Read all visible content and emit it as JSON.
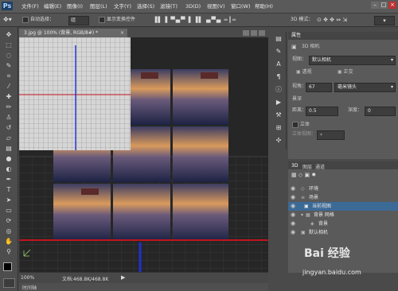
{
  "app": {
    "logo": "Ps"
  },
  "menu": [
    "文件(F)",
    "编辑(E)",
    "图像(I)",
    "图层(L)",
    "文字(Y)",
    "选择(S)",
    "滤镜(T)",
    "3D(D)",
    "视图(V)",
    "窗口(W)",
    "帮助(H)"
  ],
  "window_controls": [
    "–",
    "□",
    "×"
  ],
  "options": {
    "auto_select_label": "自动选择：",
    "auto_select_value": "组",
    "show_transform_label": "显示变换控件",
    "mode_3d_label": "3D 模式："
  },
  "document": {
    "tab_title": "3.jpg @ 100% (背景, RGB/8#) *",
    "close": "×"
  },
  "status": {
    "zoom": "100%",
    "doc_info": "文档:468.8K/468.8K",
    "timeline": "时间轴"
  },
  "properties": {
    "tabs": [
      "属性"
    ],
    "header": "3D 相机",
    "view_label": "视图：",
    "view_value": "默认相机",
    "perspective_label": "透视",
    "ortho_label": "正交",
    "fov_label": "视角：",
    "fov_value": "67",
    "lens_value": "毫米镜头",
    "dof_label": "景深",
    "distance_label": "距离：",
    "distance_value": "0.5",
    "depth_label": "深度：",
    "depth_value": "0",
    "stereo_label": "立体",
    "stereo_view_label": "立体视图："
  },
  "layers": {
    "tabs": [
      "3D",
      "图层",
      "通道"
    ],
    "rows": [
      "环境",
      "场景",
      "当前视图",
      "背景 网格",
      "背景",
      "默认相机"
    ]
  },
  "watermark": {
    "brand": "Bai 经验",
    "url": "jingyan.baidu.com"
  },
  "colors": {
    "accent_red": "#c0141e",
    "accent_blue": "#1e2fd6",
    "highlight_row": "#3c6a96"
  }
}
